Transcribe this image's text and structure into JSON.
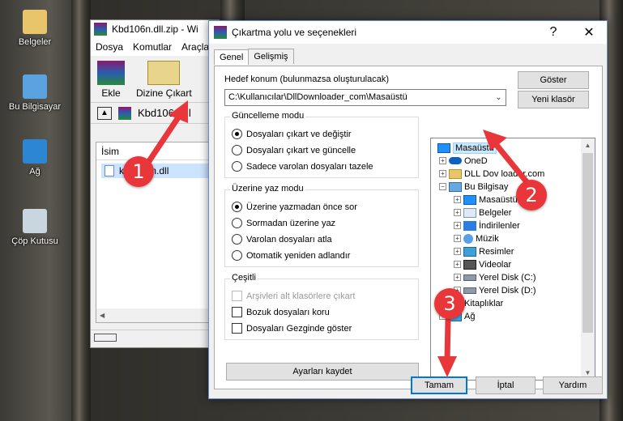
{
  "desktop": {
    "icons": [
      {
        "label": "Belgeler",
        "icon": "documents-folder-icon"
      },
      {
        "label": "Bu Bilgisayar",
        "icon": "this-pc-icon"
      },
      {
        "label": "Ağ",
        "icon": "network-icon"
      },
      {
        "label": "Çöp Kutusu",
        "icon": "recycle-bin-icon"
      }
    ]
  },
  "winrar": {
    "title": "Kbd106n.dll.zip - Wi",
    "menu": [
      "Dosya",
      "Komutlar",
      "Araçla"
    ],
    "toolbar": {
      "add_label": "Ekle",
      "extract_label": "Dizine Çıkart"
    },
    "path": "Kbd106n.dl",
    "column_name": "İsim",
    "file_name": "kbd106n.dll"
  },
  "dialog": {
    "title": "Çıkartma yolu ve seçenekleri",
    "help_glyph": "?",
    "close_glyph": "✕",
    "tabs": [
      "Genel",
      "Gelişmiş"
    ],
    "target_label": "Hedef konum (bulunmazsa oluşturulacak)",
    "target_value": "C:\\Kullanıcılar\\DllDownloader_com\\Masaüstü",
    "show_button": "Göster",
    "new_folder_button": "Yeni klasör",
    "update_mode": {
      "label": "Güncelleme modu",
      "options": [
        "Dosyaları çıkart ve değiştir",
        "Dosyaları çıkart ve güncelle",
        "Sadece varolan dosyaları tazele"
      ],
      "selected": 0
    },
    "overwrite_mode": {
      "label": "Üzerine yaz modu",
      "options": [
        "Üzerine yazmadan önce sor",
        "Sormadan üzerine yaz",
        "Varolan dosyaları atla",
        "Otomatik yeniden adlandır"
      ],
      "selected": 0
    },
    "misc": {
      "label": "Çeşitli",
      "options": [
        "Arşivleri alt klasörlere çıkart",
        "Bozuk dosyaları koru",
        "Dosyaları Gezginde göster"
      ],
      "disabled": [
        true,
        false,
        false
      ]
    },
    "save_settings_button": "Ayarları kaydet",
    "tree": [
      {
        "label": "Masaüstü",
        "icon": "desktop-icon",
        "level": 0,
        "selected": true
      },
      {
        "label": "OneD",
        "icon": "onedrive-icon",
        "level": 1,
        "expander": "+"
      },
      {
        "label": "DLL Dov loader.com",
        "icon": "folder-icon",
        "level": 1,
        "expander": "+"
      },
      {
        "label": "Bu Bilgisay",
        "icon": "this-pc-icon",
        "level": 1,
        "expander": "−"
      },
      {
        "label": "Masaüstü",
        "icon": "desktop-icon",
        "level": 2,
        "expander": "+"
      },
      {
        "label": "Belgeler",
        "icon": "documents-icon",
        "level": 2,
        "expander": "+"
      },
      {
        "label": "İndirilenler",
        "icon": "downloads-icon",
        "level": 2,
        "expander": "+"
      },
      {
        "label": "Müzik",
        "icon": "music-icon",
        "level": 2,
        "expander": "+"
      },
      {
        "label": "Resimler",
        "icon": "pictures-icon",
        "level": 2,
        "expander": "+"
      },
      {
        "label": "Videolar",
        "icon": "videos-icon",
        "level": 2,
        "expander": "+"
      },
      {
        "label": "Yerel Disk (C:)",
        "icon": "drive-icon",
        "level": 2,
        "expander": "+"
      },
      {
        "label": "Yerel Disk (D:)",
        "icon": "drive-icon",
        "level": 2,
        "expander": "+"
      },
      {
        "label": "Kitaplıklar",
        "icon": "libraries-icon",
        "level": 1,
        "expander": "+"
      },
      {
        "label": "Ağ",
        "icon": "network-icon",
        "level": 1,
        "expander": "+"
      }
    ],
    "ok_button": "Tamam",
    "cancel_button": "İptal",
    "help_button": "Yardım"
  },
  "markers": [
    "1",
    "2",
    "3"
  ],
  "colors": {
    "marker": "#e8363a",
    "selection": "#cce8ff",
    "accent": "#0078d7"
  }
}
